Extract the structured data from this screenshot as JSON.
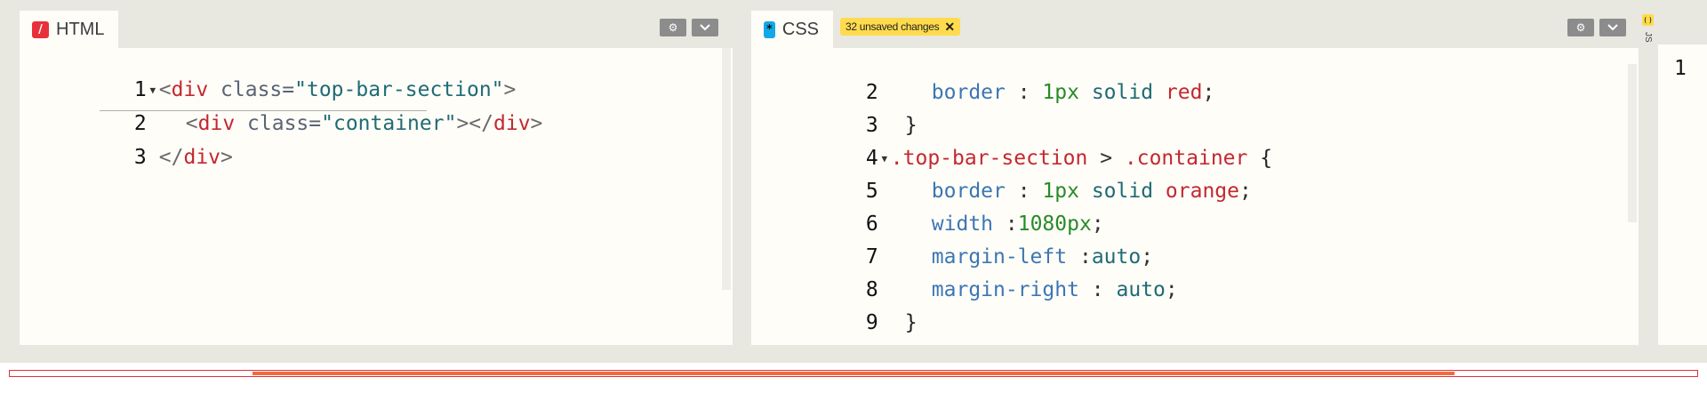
{
  "html_panel": {
    "tab_label": "HTML",
    "tab_icon": "html-icon",
    "icon_glyph": "/",
    "icon_color": "#e8303a",
    "settings_icon": "gear-icon",
    "collapse_icon": "chevron-down-icon",
    "lines": [
      {
        "number": "1"
      },
      {
        "number": "2"
      },
      {
        "number": "3"
      }
    ]
  },
  "css_panel": {
    "tab_label": "CSS",
    "tab_icon": "css-icon",
    "icon_glyph": "*",
    "icon_color": "#11a9e8",
    "unsaved_badge": "32 unsaved changes",
    "badge_close_glyph": "✕",
    "badge_color": "#ffdb4d",
    "settings_icon": "gear-icon",
    "collapse_icon": "chevron-down-icon",
    "lines": [
      {
        "number": "2",
        "tokens": [
          "border",
          " : ",
          "1px",
          " solid ",
          "red",
          ";"
        ]
      },
      {
        "number": "3",
        "tokens": [
          "}"
        ]
      },
      {
        "number": "4",
        "tokens": [
          ".top-bar-section",
          " > ",
          ".container",
          " {"
        ]
      },
      {
        "number": "5",
        "tokens": [
          "border",
          " : ",
          "1px",
          " solid ",
          "orange",
          ";"
        ]
      },
      {
        "number": "6",
        "tokens": [
          "width",
          " :",
          "1080px",
          ";"
        ]
      },
      {
        "number": "7",
        "tokens": [
          "margin-left",
          " :",
          "auto",
          ";"
        ]
      },
      {
        "number": "8",
        "tokens": [
          "margin-right",
          " : ",
          "auto",
          ";"
        ]
      },
      {
        "number": "9",
        "tokens": [
          "}"
        ]
      }
    ]
  },
  "js_panel": {
    "label": "JS",
    "icon": "js-icon",
    "icon_color": "#ffdb4d"
  },
  "result_panel": {
    "line_number": "1"
  },
  "html_code": {
    "l1_open": "<",
    "l1_tag": "div",
    "l1_attr": " class=",
    "l1_str": "\"top-bar-section\"",
    "l1_close": ">",
    "l2_open": "<",
    "l2_tag": "div",
    "l2_attr": " class=",
    "l2_str": "\"container\"",
    "l2_mid": "></",
    "l2_tag2": "div",
    "l2_close": ">",
    "l3_open": "</",
    "l3_tag": "div",
    "l3_close": ">"
  },
  "colors": {
    "preview_outer_border": "#e0303a",
    "preview_inner_bar": "#f26c3b"
  }
}
